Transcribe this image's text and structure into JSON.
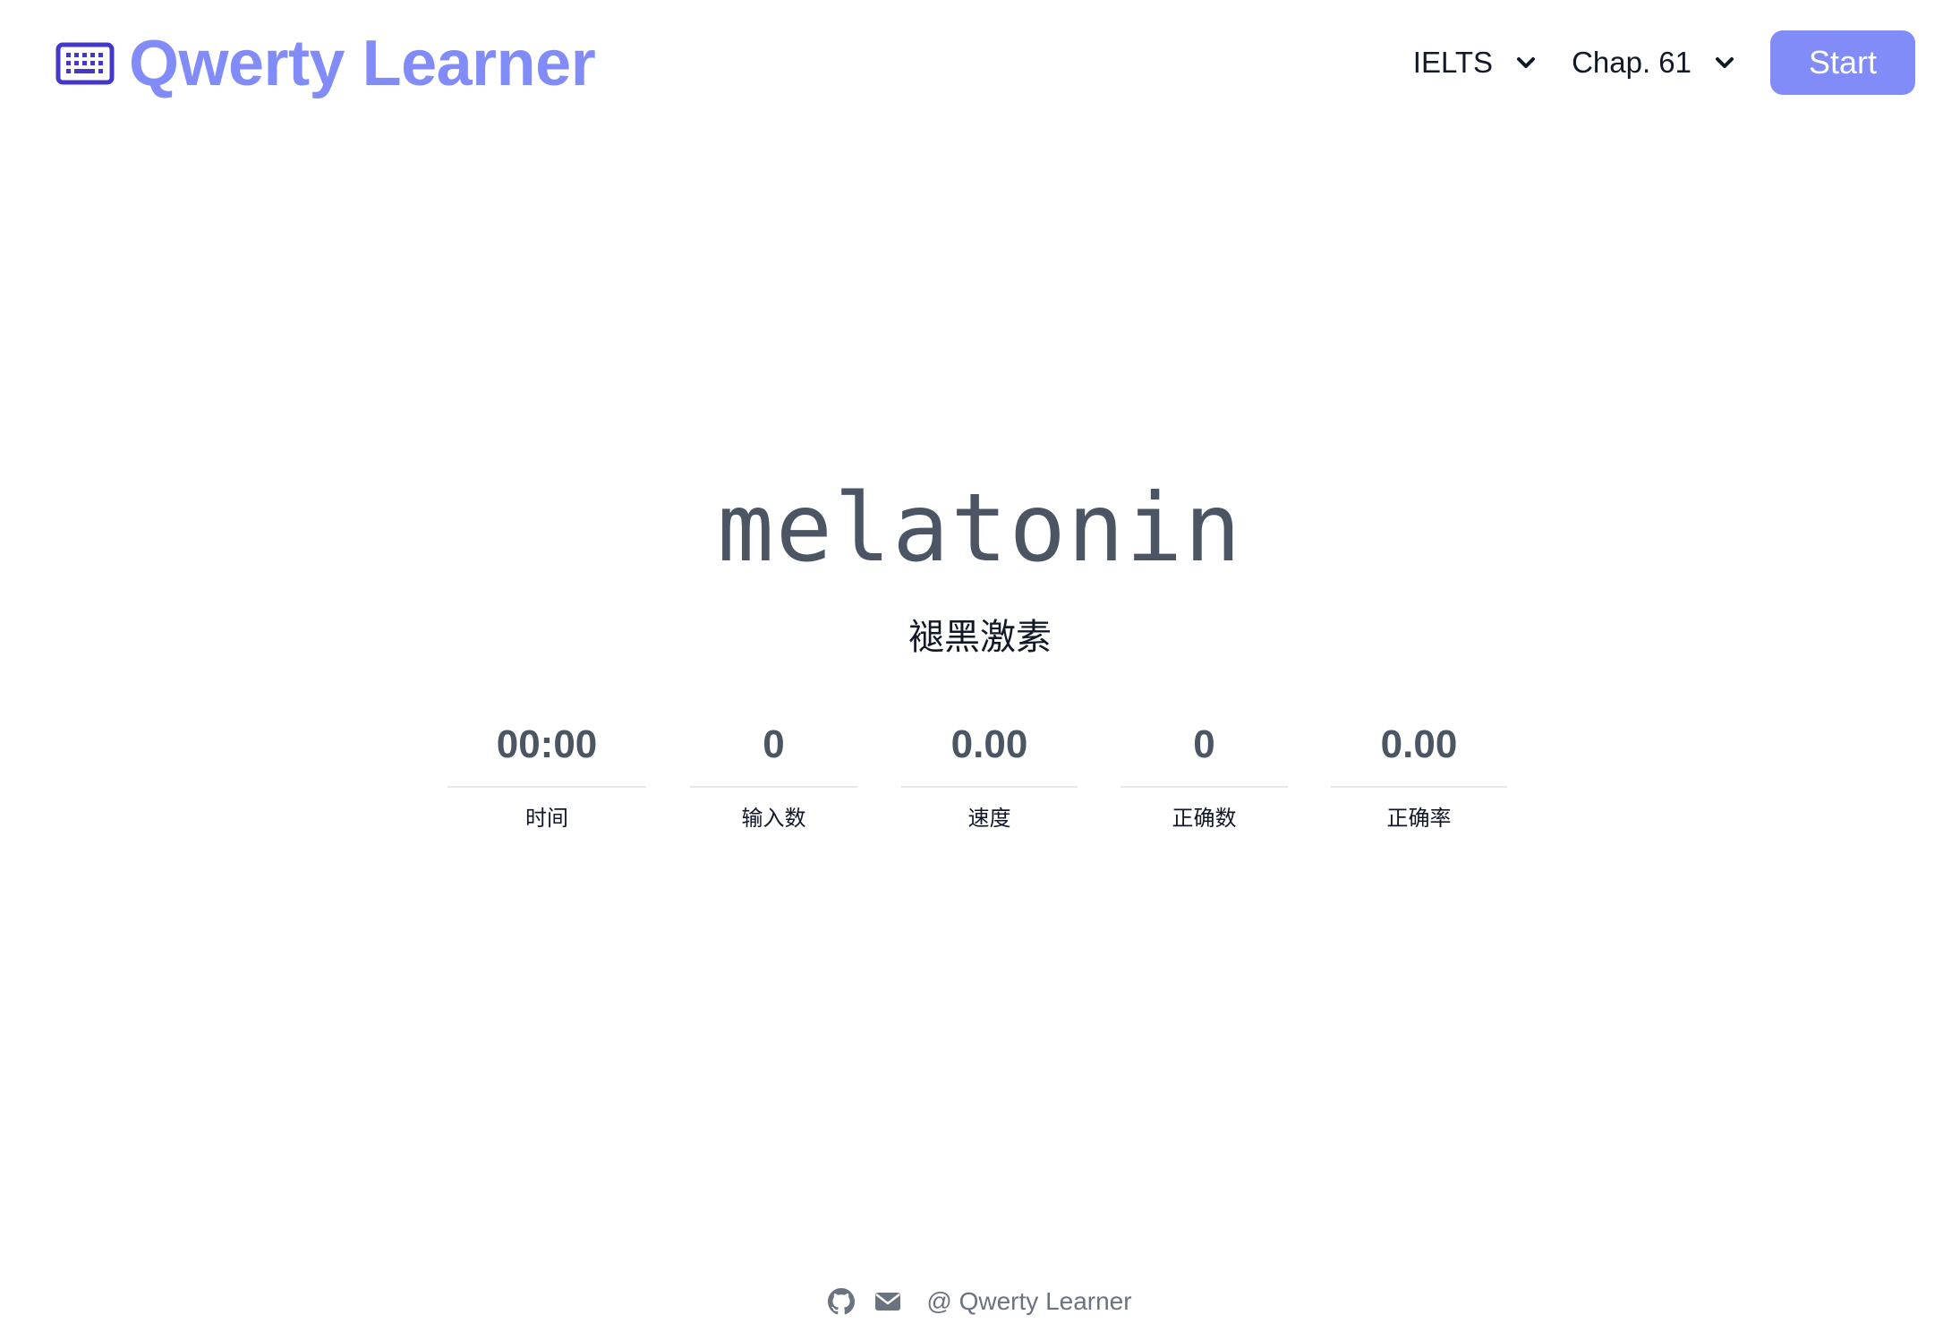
{
  "header": {
    "brand_name": "Qwerty Learner",
    "brand_icon": "keyboard-icon",
    "dictionary_select": "IELTS",
    "chapter_select": "Chap. 61",
    "start_button": "Start"
  },
  "word": {
    "text": "melatonin",
    "translation": "褪黑激素"
  },
  "stats": [
    {
      "value": "00:00",
      "label": "时间"
    },
    {
      "value": "0",
      "label": "输入数"
    },
    {
      "value": "0.00",
      "label": "速度"
    },
    {
      "value": "0",
      "label": "正确数"
    },
    {
      "value": "0.00",
      "label": "正确率"
    }
  ],
  "footer": {
    "icons": [
      "github-icon",
      "mail-icon"
    ],
    "copyright": "@ Qwerty Learner"
  },
  "colors": {
    "accent": "#818cf8",
    "brand_icon": "#4338ca",
    "word_text": "#4b5563",
    "muted": "#6b7280"
  }
}
